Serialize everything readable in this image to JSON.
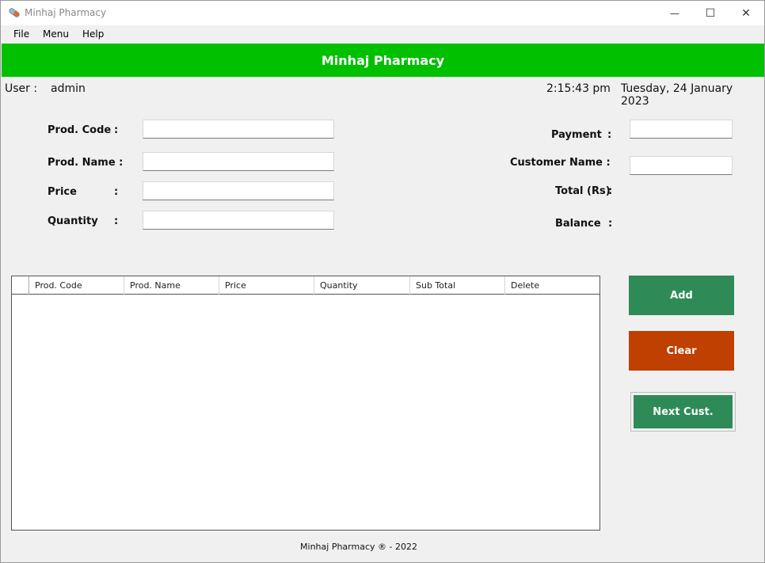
{
  "window": {
    "title": "Minhaj Pharmacy",
    "min_glyph": "—",
    "max_glyph": "☐",
    "close_glyph": "✕"
  },
  "menu": {
    "items": [
      "File",
      "Menu",
      "Help"
    ]
  },
  "header": {
    "title": "Minhaj Pharmacy",
    "color": "#00c000"
  },
  "session": {
    "user_label": "User :",
    "user_value": "admin",
    "time": "2:15:43 pm",
    "date": "Tuesday, 24 January 2023"
  },
  "form": {
    "prod_code_label": "Prod. Code",
    "prod_name_label": "Prod. Name :",
    "price_label": "Price",
    "quantity_label": "Quantity",
    "colon": ":",
    "prod_code_value": "",
    "prod_name_value": "",
    "price_value": "",
    "quantity_value": ""
  },
  "summary": {
    "payment_label": "Payment",
    "customer_name_label": "Customer Name :",
    "total_label": "Total (Rs)",
    "balance_label": "Balance",
    "colon": ":",
    "payment_value": "",
    "customer_name_value": ""
  },
  "grid": {
    "columns": [
      "Prod. Code",
      "Prod. Name",
      "Price",
      "Quantity",
      "Sub Total",
      "Delete"
    ],
    "rows": []
  },
  "buttons": {
    "add": "Add",
    "clear": "Clear",
    "next": "Next Cust.",
    "add_color": "#2e8b57",
    "clear_color": "#bf4000"
  },
  "footer": {
    "text": "Minhaj Pharmacy ® - 2022"
  }
}
